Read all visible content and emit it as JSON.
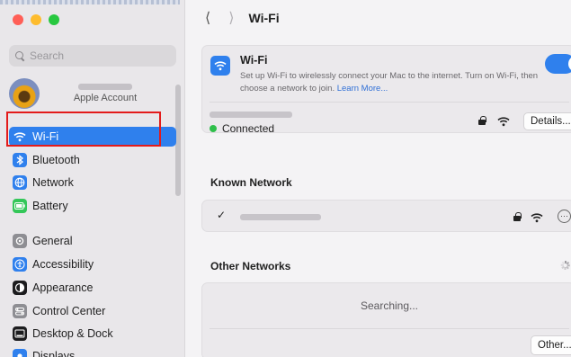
{
  "window": {
    "title": "Wi-Fi"
  },
  "sidebar": {
    "search_placeholder": "Search",
    "account_label": "Apple Account",
    "items": [
      {
        "label": "Wi-Fi",
        "icon": "wifi-icon",
        "color": "#2f80ed",
        "selected": true
      },
      {
        "label": "Bluetooth",
        "icon": "bluetooth-icon",
        "color": "#2f80ed"
      },
      {
        "label": "Network",
        "icon": "globe-icon",
        "color": "#2f80ed"
      },
      {
        "label": "Battery",
        "icon": "battery-icon",
        "color": "#34c759"
      },
      {
        "label": "General",
        "icon": "gear-icon",
        "color": "#8e8e93"
      },
      {
        "label": "Accessibility",
        "icon": "accessibility-icon",
        "color": "#2f80ed"
      },
      {
        "label": "Appearance",
        "icon": "appearance-icon",
        "color": "#1c1c1e"
      },
      {
        "label": "Control Center",
        "icon": "control-center-icon",
        "color": "#8e8e93"
      },
      {
        "label": "Desktop & Dock",
        "icon": "dock-icon",
        "color": "#1c1c1e"
      },
      {
        "label": "Displays",
        "icon": "display-icon",
        "color": "#2f80ed"
      }
    ]
  },
  "main": {
    "wifi_card": {
      "title": "Wi-Fi",
      "description": "Set up Wi-Fi to wirelessly connect your Mac to the internet. Turn on Wi-Fi, then choose a network to join.",
      "learn_more": "Learn More...",
      "toggle_on": true,
      "status": "Connected",
      "details_label": "Details..."
    },
    "known_network": {
      "heading": "Known Network",
      "check": "✓"
    },
    "other_networks": {
      "heading": "Other Networks",
      "searching": "Searching...",
      "other_label": "Other..."
    }
  },
  "colors": {
    "accent": "#2f80ed",
    "highlight_outline": "#e31b1b",
    "connected": "#2fbf4b"
  }
}
